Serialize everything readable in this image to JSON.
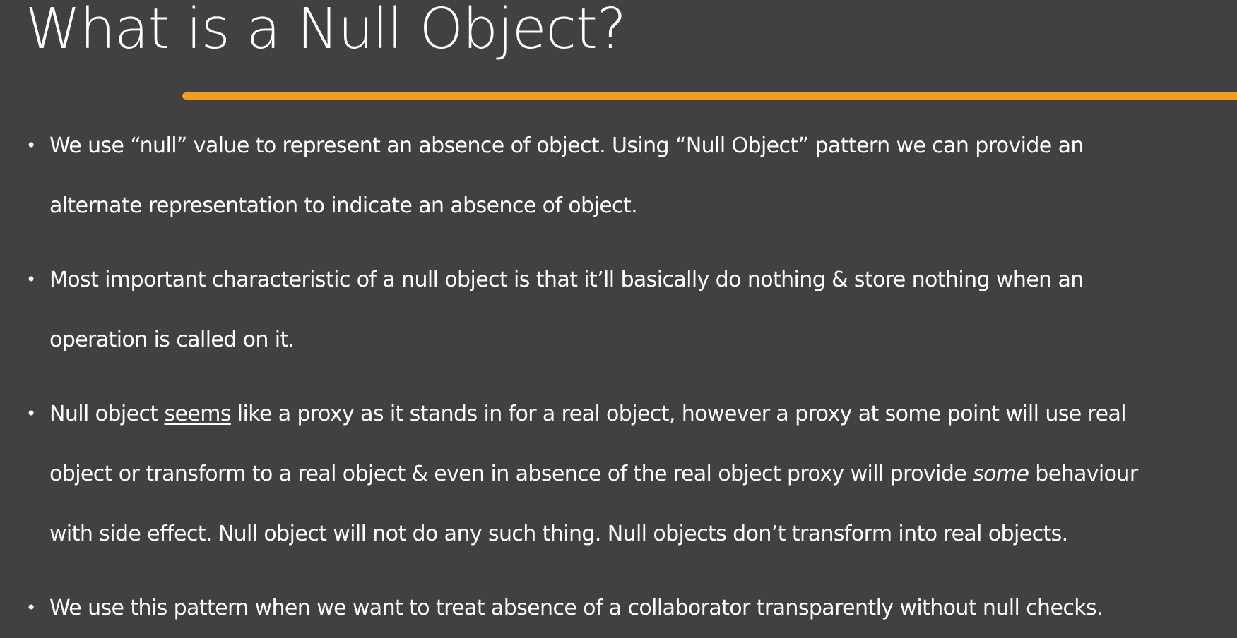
{
  "slide": {
    "title": "What is a Null Object?",
    "accent_color": "#f39a21",
    "background_color": "#414141",
    "bullet_glyph": "•",
    "bullets": [
      {
        "lines": [
          "We use “null” value to represent an absence of object. Using “Null Object” pattern we can provide an",
          "alternate representation to indicate an absence of object."
        ]
      },
      {
        "lines": [
          "Most important characteristic of a null object is that it’ll basically do nothing & store nothing when an",
          "operation is called on it."
        ]
      },
      {
        "line1_start": "Null object ",
        "line1_underlined": "seems",
        "line1_end": " like a proxy as it stands in for a real object, however a proxy at some point will use real",
        "line2_start": "object or transform to a real object & even in absence of the real object proxy will provide ",
        "line2_italic": "some",
        "line2_end": " behaviour",
        "line3": "with side effect. Null object will not do any such thing. Null objects don’t transform into real objects."
      },
      {
        "lines": [
          "We use this pattern when we want to treat absence of a collaborator transparently without null checks."
        ]
      }
    ]
  }
}
